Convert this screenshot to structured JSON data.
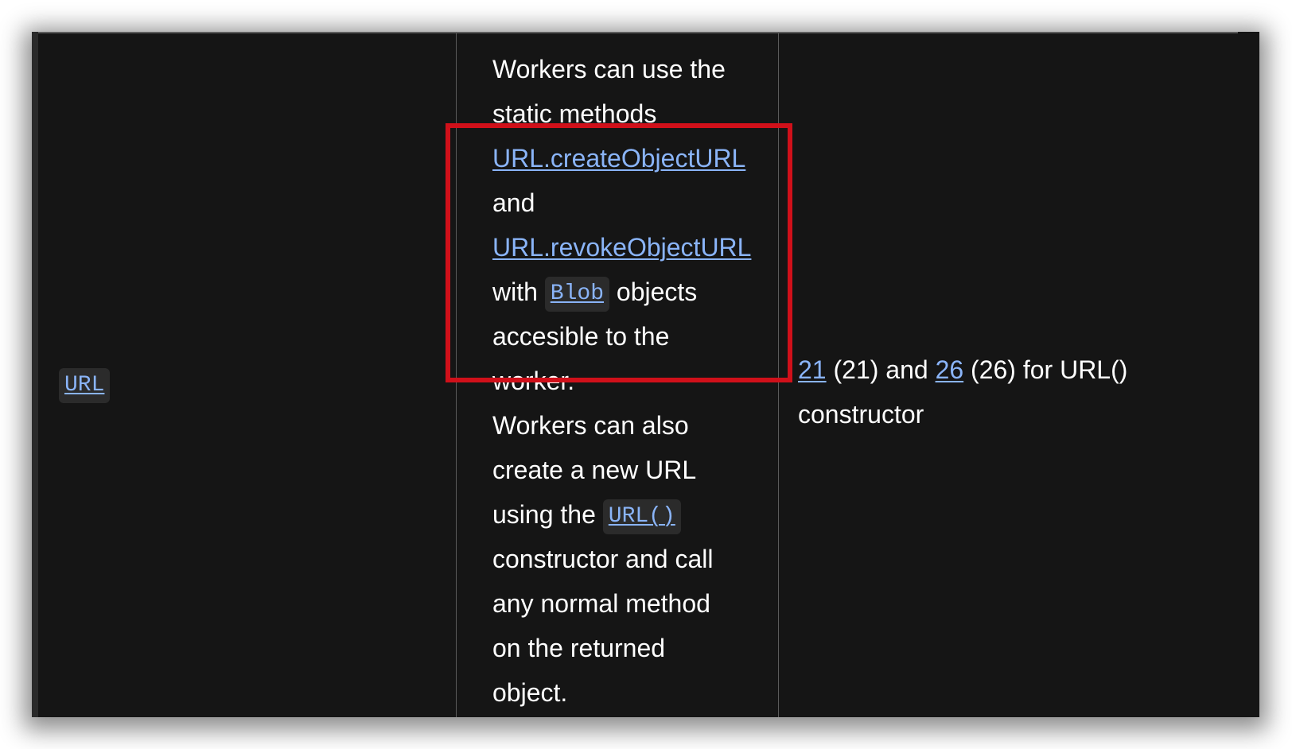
{
  "table": {
    "row": {
      "api": {
        "code": "URL"
      },
      "description": {
        "lines": [
          "Workers can use the",
          "static methods",
          "URL.createObjectURL",
          "and",
          "URL.revokeObjectURL",
          "with",
          "Blob",
          "objects",
          "accesible to the",
          "worker.",
          "Workers can also",
          "create a new URL",
          "using the",
          "URL()",
          "constructor and call",
          "any normal method",
          "on the returned",
          "object."
        ]
      },
      "support": {
        "link1": "21",
        "text1": "(21) and",
        "link2": "26",
        "text2": "(26) for URL()",
        "text3": "constructor"
      }
    }
  },
  "highlight": {
    "color": "#d0101a"
  },
  "colors": {
    "background": "#151515",
    "text": "#ffffff",
    "link": "#8ab4f8",
    "code_bg": "#2b2b2b"
  }
}
